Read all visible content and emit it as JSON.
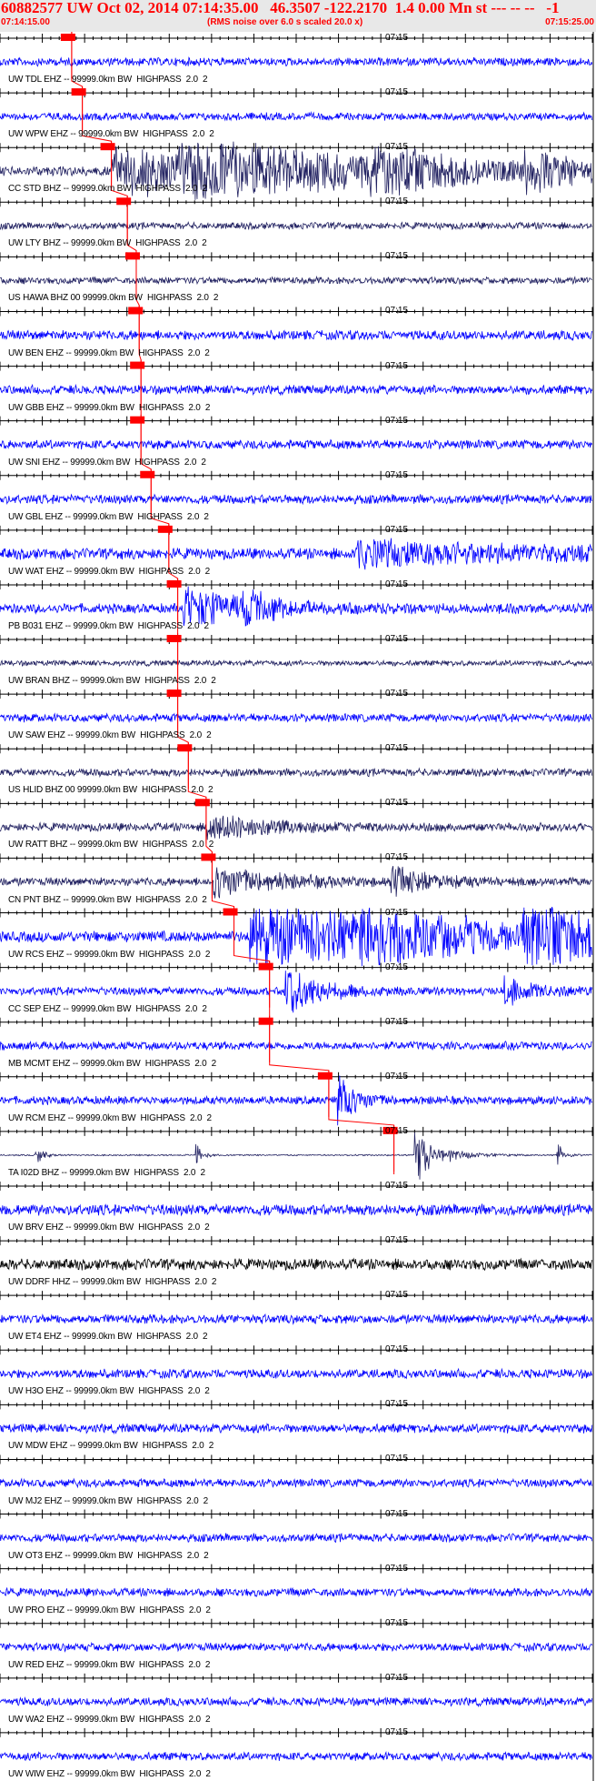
{
  "header": {
    "title": "60882577 UW Oct 02, 2014 07:14:35.00   46.3507 -122.2170  1.4 0.00 Mn st --- -- --   -1",
    "start_time": "07:14:15.00",
    "end_time": "07:15:25.00",
    "subtitle": "(RMS noise over 6.0 s scaled 20.0 x)"
  },
  "colors": {
    "trace_blue": "#0000ff",
    "trace_dark": "#202060",
    "trace_black": "#000000",
    "pick_red": "#ff0000"
  },
  "chart_data": {
    "type": "line",
    "x_unit": "time",
    "x_range": [
      "07:14:15.00",
      "07:15:25.00"
    ],
    "minute_marker": "07:15",
    "traces": [
      {
        "station": "UW TDL EHZ -- 99999.0km BW  HIGHPASS  2.0  2",
        "color": "blue",
        "amp": 0.3,
        "pick": 0.121,
        "bursts": []
      },
      {
        "station": "UW WPW EHZ -- 99999.0km BW  HIGHPASS  2.0  2",
        "color": "blue",
        "amp": 0.28,
        "pick": 0.139,
        "bursts": []
      },
      {
        "station": "CC STD BHZ -- 99999.0km BW  HIGHPASS  2.0  2",
        "color": "dark",
        "amp": 0.35,
        "pick": 0.188,
        "bursts": [
          [
            0.19,
            0.55,
            0.9
          ],
          [
            0.3,
            0.2,
            0.7
          ],
          [
            0.62,
            0.1,
            0.7
          ],
          [
            0.88,
            0.06,
            0.8
          ]
        ]
      },
      {
        "station": "UW LTY BHZ -- 99999.0km BW  HIGHPASS  2.0  2",
        "color": "dark",
        "amp": 0.25,
        "pick": 0.215,
        "bursts": []
      },
      {
        "station": "US HAWA BHZ 00 99999.0km BW  HIGHPASS  2.0  2",
        "color": "dark",
        "amp": 0.25,
        "pick": 0.23,
        "bursts": []
      },
      {
        "station": "UW BEN EHZ -- 99999.0km BW  HIGHPASS  2.0  2",
        "color": "blue",
        "amp": 0.35,
        "pick": 0.235,
        "bursts": []
      },
      {
        "station": "UW GBB EHZ -- 99999.0km BW  HIGHPASS  2.0  2",
        "color": "blue",
        "amp": 0.33,
        "pick": 0.238,
        "bursts": []
      },
      {
        "station": "UW SNI EHZ -- 99999.0km BW  HIGHPASS  2.0  2",
        "color": "blue",
        "amp": 0.33,
        "pick": 0.238,
        "bursts": []
      },
      {
        "station": "UW GBL EHZ -- 99999.0km BW  HIGHPASS  2.0  2",
        "color": "blue",
        "amp": 0.33,
        "pick": 0.255,
        "bursts": []
      },
      {
        "station": "UW WAT EHZ -- 99999.0km BW  HIGHPASS  2.0  2",
        "color": "blue",
        "amp": 0.4,
        "pick": 0.285,
        "bursts": [
          [
            0.6,
            0.35,
            0.5
          ]
        ]
      },
      {
        "station": "PB B031 EHZ -- 99999.0km BW  HIGHPASS  2.0  2",
        "color": "blue",
        "amp": 0.35,
        "pick": 0.3,
        "bursts": [
          [
            0.31,
            0.1,
            0.9
          ],
          [
            0.41,
            0.04,
            0.6
          ]
        ]
      },
      {
        "station": "UW BRAN BHZ -- 99999.0km BW  HIGHPASS  2.0  2",
        "color": "dark",
        "amp": 0.2,
        "pick": 0.3,
        "bursts": []
      },
      {
        "station": "UW SAW EHZ -- 99999.0km BW  HIGHPASS  2.0  2",
        "color": "blue",
        "amp": 0.3,
        "pick": 0.3,
        "bursts": []
      },
      {
        "station": "US HLID BHZ 00 99999.0km BW  HIGHPASS  2.0  2",
        "color": "dark",
        "amp": 0.28,
        "pick": 0.318,
        "bursts": []
      },
      {
        "station": "UW RATT BHZ -- 99999.0km BW  HIGHPASS  2.0  2",
        "color": "dark",
        "amp": 0.3,
        "pick": 0.348,
        "bursts": [
          [
            0.35,
            0.1,
            0.6
          ]
        ]
      },
      {
        "station": "CN PNT BHZ -- 99999.0km BW  HIGHPASS  2.0  2",
        "color": "dark",
        "amp": 0.3,
        "pick": 0.358,
        "bursts": [
          [
            0.36,
            0.1,
            0.7
          ],
          [
            0.66,
            0.06,
            0.6
          ]
        ]
      },
      {
        "station": "UW RCS EHZ -- 99999.0km BW  HIGHPASS  2.0  2",
        "color": "blue",
        "amp": 0.4,
        "pick": 0.395,
        "bursts": [
          [
            0.42,
            0.3,
            1.4
          ],
          [
            0.6,
            0.15,
            0.7
          ],
          [
            0.88,
            0.12,
            1.4
          ]
        ]
      },
      {
        "station": "CC SEP EHZ -- 99999.0km BW  HIGHPASS  2.0  2",
        "color": "blue",
        "amp": 0.3,
        "pick": 0.455,
        "bursts": [
          [
            0.48,
            0.05,
            1.2
          ],
          [
            0.85,
            0.05,
            0.5
          ]
        ]
      },
      {
        "station": "MB MCMT EHZ -- 99999.0km BW  HIGHPASS  2.0  2",
        "color": "blue",
        "amp": 0.3,
        "pick": 0.455,
        "bursts": []
      },
      {
        "station": "UW RCM EHZ -- 99999.0km BW  HIGHPASS  2.0  2",
        "color": "blue",
        "amp": 0.3,
        "pick": 0.555,
        "bursts": [
          [
            0.57,
            0.03,
            1.1
          ]
        ]
      },
      {
        "station": "TA I02D BHZ -- 99999.0km BW  HIGHPASS  2.0  2",
        "color": "dark",
        "amp": 0.05,
        "pick": 0.665,
        "bursts": [
          [
            0.06,
            0.01,
            0.6
          ],
          [
            0.33,
            0.01,
            0.6
          ],
          [
            0.7,
            0.04,
            1.1
          ],
          [
            0.94,
            0.01,
            0.6
          ]
        ]
      },
      {
        "station": "UW BRV EHZ -- 99999.0km BW  HIGHPASS  2.0  2",
        "color": "blue",
        "amp": 0.4,
        "pick": null,
        "bursts": []
      },
      {
        "station": "UW DDRF HHZ -- 99999.0km BW  HIGHPASS  2.0  2",
        "color": "black",
        "amp": 0.4,
        "pick": null,
        "bursts": []
      },
      {
        "station": "UW ET4 EHZ -- 99999.0km BW  HIGHPASS  2.0  2",
        "color": "blue",
        "amp": 0.33,
        "pick": null,
        "bursts": []
      },
      {
        "station": "UW H3O EHZ -- 99999.0km BW  HIGHPASS  2.0  2",
        "color": "blue",
        "amp": 0.33,
        "pick": null,
        "bursts": []
      },
      {
        "station": "UW MDW EHZ -- 99999.0km BW  HIGHPASS  2.0  2",
        "color": "blue",
        "amp": 0.33,
        "pick": null,
        "bursts": []
      },
      {
        "station": "UW MJ2 EHZ -- 99999.0km BW  HIGHPASS  2.0  2",
        "color": "blue",
        "amp": 0.3,
        "pick": null,
        "bursts": []
      },
      {
        "station": "UW OT3 EHZ -- 99999.0km BW  HIGHPASS  2.0  2",
        "color": "blue",
        "amp": 0.3,
        "pick": null,
        "bursts": []
      },
      {
        "station": "UW PRO EHZ -- 99999.0km BW  HIGHPASS  2.0  2",
        "color": "blue",
        "amp": 0.3,
        "pick": null,
        "bursts": []
      },
      {
        "station": "UW RED EHZ -- 99999.0km BW  HIGHPASS  2.0  2",
        "color": "blue",
        "amp": 0.3,
        "pick": null,
        "bursts": []
      },
      {
        "station": "UW WA2 EHZ -- 99999.0km BW  HIGHPASS  2.0  2",
        "color": "blue",
        "amp": 0.3,
        "pick": null,
        "bursts": []
      },
      {
        "station": "UW WIW EHZ -- 99999.0km BW  HIGHPASS  2.0  2",
        "color": "blue",
        "amp": 0.3,
        "pick": null,
        "bursts": []
      }
    ]
  }
}
